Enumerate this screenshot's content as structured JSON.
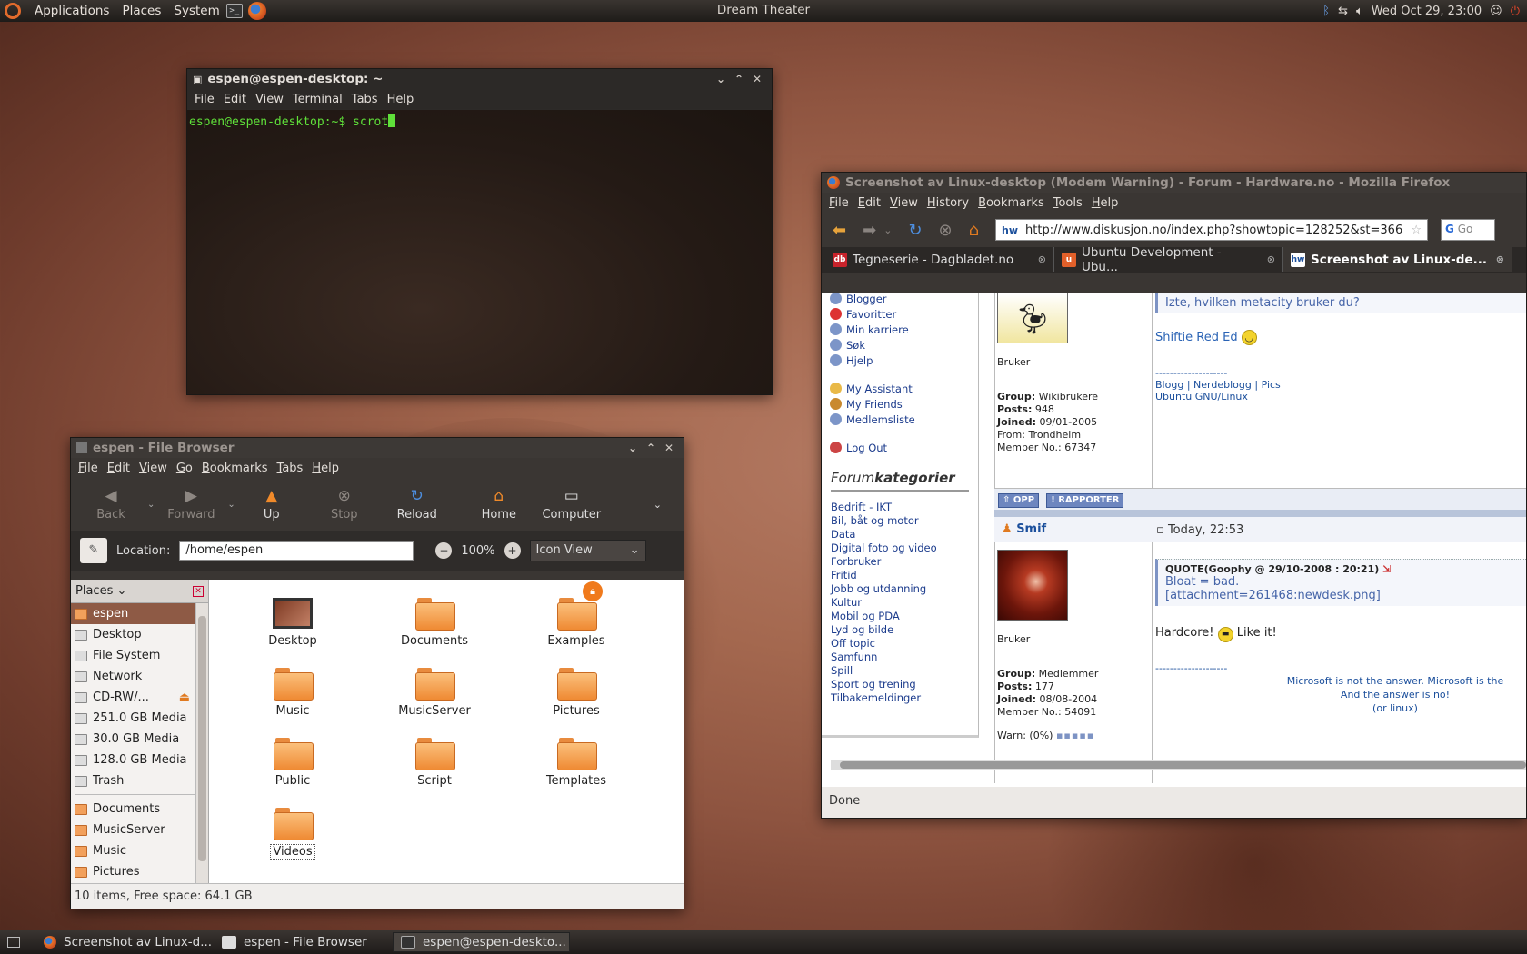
{
  "top_panel": {
    "menus": [
      "Applications",
      "Places",
      "System"
    ],
    "title": "Dream Theater",
    "clock": "Wed Oct 29, 23:00"
  },
  "terminal": {
    "title": "espen@espen-desktop: ~",
    "menu": [
      "File",
      "Edit",
      "View",
      "Terminal",
      "Tabs",
      "Help"
    ],
    "prompt": "espen@espen-desktop:~$ ",
    "command": "scrot"
  },
  "file_browser": {
    "title": "espen - File Browser",
    "menu": [
      "File",
      "Edit",
      "View",
      "Go",
      "Bookmarks",
      "Tabs",
      "Help"
    ],
    "toolbar": {
      "back": "Back",
      "forward": "Forward",
      "up": "Up",
      "stop": "Stop",
      "reload": "Reload",
      "home": "Home",
      "computer": "Computer"
    },
    "location_label": "Location:",
    "location": "/home/espen",
    "zoom": "100%",
    "view": "Icon View",
    "places_label": "Places",
    "places": [
      "espen",
      "Desktop",
      "File System",
      "Network",
      "CD-RW/...",
      "251.0 GB Media",
      "30.0 GB Media",
      "128.0 GB Media",
      "Trash"
    ],
    "bookmarks": [
      "Documents",
      "MusicServer",
      "Music",
      "Pictures"
    ],
    "items": [
      "Desktop",
      "Documents",
      "Examples",
      "Music",
      "MusicServer",
      "Pictures",
      "Public",
      "Script",
      "Templates",
      "Videos"
    ],
    "status": "10 items, Free space: 64.1 GB"
  },
  "firefox": {
    "title": "Screenshot av Linux-desktop (Modem Warning) - Forum - Hardware.no - Mozilla Firefox",
    "menu": [
      "File",
      "Edit",
      "View",
      "History",
      "Bookmarks",
      "Tools",
      "Help"
    ],
    "url": "http://www.diskusjon.no/index.php?showtopic=128252&st=366",
    "search_placeholder": "Go",
    "tabs": [
      "Tegneserie - Dagbladet.no",
      "Ubuntu Development - Ubu...",
      "Screenshot av Linux-de..."
    ],
    "left_links": [
      "Blogger",
      "Favoritter",
      "Min karriere",
      "Søk",
      "Hjelp"
    ],
    "left_links2": [
      "My Assistant",
      "My Friends",
      "Medlemsliste"
    ],
    "logout": "Log Out",
    "category_title_a": "Forum",
    "category_title_b": "kategorier",
    "categories": [
      "Bedrift - IKT",
      "Bil, båt og motor",
      "Data",
      "Digital foto og video",
      "Forbruker",
      "Fritid",
      "Jobb og utdanning",
      "Kultur",
      "Mobil og PDA",
      "Lyd og bilde",
      "Off topic",
      "Samfunn",
      "Spill",
      "Sport og trening",
      "Tilbakemeldinger"
    ],
    "post1": {
      "role": "Bruker",
      "group_label": "Group:",
      "group": "Wikibrukere",
      "posts_label": "Posts:",
      "posts": "948",
      "joined_label": "Joined:",
      "joined": "09/01-2005",
      "from": "From: Trondheim",
      "member": "Member No.: 67347",
      "quote_text": "Izte, hvilken metacity bruker du?",
      "body": "Shiftie Red Ed",
      "sig_line": "--------------------",
      "sig_links": [
        "Blogg",
        "Nerdeblogg",
        "Pics"
      ],
      "sig_sep": "|",
      "sig2": "Ubuntu GNU/Linux"
    },
    "buttons": {
      "up": "OPP",
      "report": "RAPPORTER"
    },
    "post2": {
      "author": "Smif",
      "date": "Today, 22:53",
      "role": "Bruker",
      "group_label": "Group:",
      "group": "Medlemmer",
      "posts_label": "Posts:",
      "posts": "177",
      "joined_label": "Joined:",
      "joined": "08/08-2004",
      "member": "Member No.: 54091",
      "warn": "Warn: (0%)",
      "quote_head": "QUOTE(Goophy @ 29/10-2008 : 20:21)",
      "quote_line1": "Bloat = bad.",
      "quote_line2": "[attachment=261468:newdesk.png]",
      "body_a": "Hardcore!",
      "body_b": "Like it!",
      "sig_line": "--------------------",
      "sig1": "Microsoft is not the answer. Microsoft is the",
      "sig2": "And the answer is no!",
      "sig3": "(or linux)"
    },
    "status": "Done"
  },
  "taskbar": [
    "Screenshot av Linux-d...",
    "espen - File Browser",
    "espen@espen-deskto..."
  ]
}
